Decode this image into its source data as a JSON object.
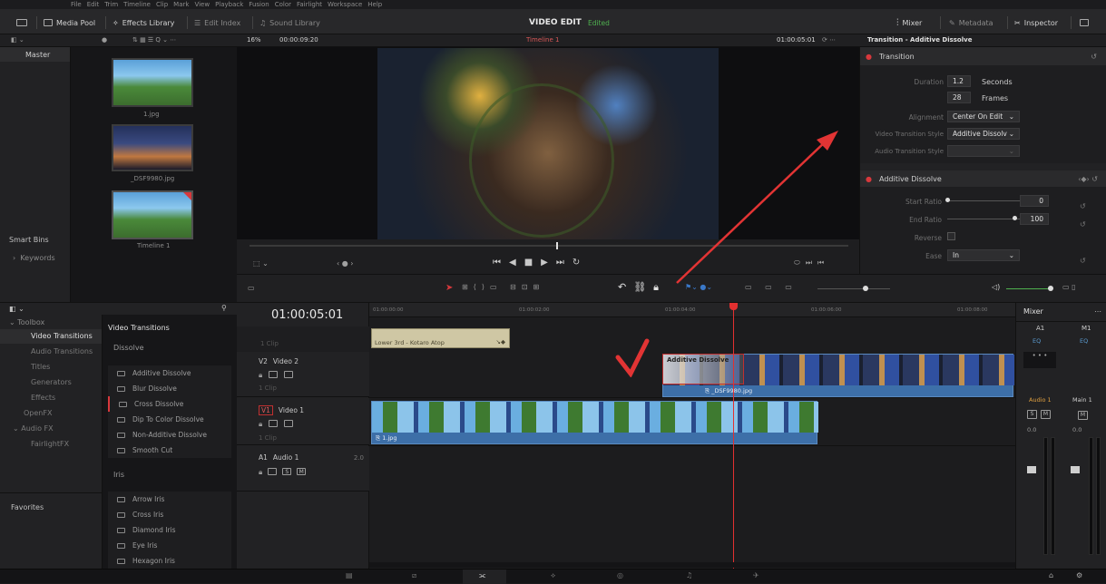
{
  "menu": [
    "File",
    "Edit",
    "Trim",
    "Timeline",
    "Clip",
    "Mark",
    "View",
    "Playback",
    "Fusion",
    "Color",
    "Fairlight",
    "Workspace",
    "Help"
  ],
  "toolbar": {
    "media_pool": "Media Pool",
    "effects_library": "Effects Library",
    "edit_index": "Edit Index",
    "sound_library": "Sound Library",
    "project_title": "VIDEO EDIT",
    "project_status": "Edited",
    "mixer": "Mixer",
    "metadata": "Metadata",
    "inspector": "Inspector"
  },
  "viewer_bar": {
    "zoom": "16%",
    "duration": "00:00:09:20",
    "timeline_name": "Timeline 1",
    "timecode": "01:00:05:01",
    "inspector_title": "Transition - Additive Dissolve"
  },
  "media_pool": {
    "root": "Master",
    "smart_bins": "Smart Bins",
    "keywords": "Keywords",
    "clips": [
      {
        "name": "1.jpg"
      },
      {
        "name": "_DSF9980.jpg"
      },
      {
        "name": "Timeline 1"
      }
    ]
  },
  "effects": {
    "toolbox": "Toolbox",
    "tree": [
      "Video Transitions",
      "Audio Transitions",
      "Titles",
      "Generators",
      "Effects",
      "OpenFX",
      "Audio FX",
      "FairlightFX"
    ],
    "favorites": "Favorites",
    "list_title": "Video Transitions",
    "group1": "Dissolve",
    "dissolves": [
      "Additive Dissolve",
      "Blur Dissolve",
      "Cross Dissolve",
      "Dip To Color Dissolve",
      "Non-Additive Dissolve",
      "Smooth Cut"
    ],
    "group2": "Iris",
    "irises": [
      "Arrow Iris",
      "Cross Iris",
      "Diamond Iris",
      "Eye Iris",
      "Hexagon Iris"
    ]
  },
  "timeline": {
    "timecode": "01:00:05:01",
    "ruler": [
      "01:00:00:00",
      "01:00:02:00",
      "01:00:04:00",
      "01:00:06:00",
      "01:00:08:00"
    ],
    "v3_clip_count": "1 Clip",
    "v2_label": "V2",
    "v2_name": "Video 2",
    "v2_clip_count": "1 Clip",
    "v1_label": "V1",
    "v1_name": "Video 1",
    "v1_clip_count": "1 Clip",
    "a1_label": "A1",
    "a1_name": "Audio 1",
    "a1_level": "2.0",
    "title_clip": "Lower 3rd - Kotaro Atop",
    "transition_clip": "Additive Dissolve",
    "v2_clip": "_DSF9980.jpg",
    "v1_clip": "1.jpg"
  },
  "inspector": {
    "section1": "Transition",
    "duration_label": "Duration",
    "duration_value": "1.2",
    "duration_unit": "Seconds",
    "frames_value": "28",
    "frames_unit": "Frames",
    "alignment_label": "Alignment",
    "alignment_value": "Center On Edit",
    "style_label": "Video Transition Style",
    "style_value": "Additive Dissolv",
    "audio_style_label": "Audio Transition Style",
    "section2": "Additive Dissolve",
    "start_label": "Start Ratio",
    "start_value": "0",
    "end_label": "End Ratio",
    "end_value": "100",
    "reverse_label": "Reverse",
    "ease_label": "Ease",
    "ease_value": "In"
  },
  "mixer": {
    "title": "Mixer",
    "channels": [
      "A1",
      "M1"
    ],
    "eq": "EQ",
    "ch_names": [
      "Audio 1",
      "Main 1"
    ],
    "s": "S",
    "m": "M",
    "level": "0.0"
  },
  "colors": {
    "accent_red": "#d8383c",
    "selected_blue": "#3a78c8",
    "playhead": "#e23030",
    "annotation": "#e23434",
    "title_clip": "#cfc7a4"
  }
}
